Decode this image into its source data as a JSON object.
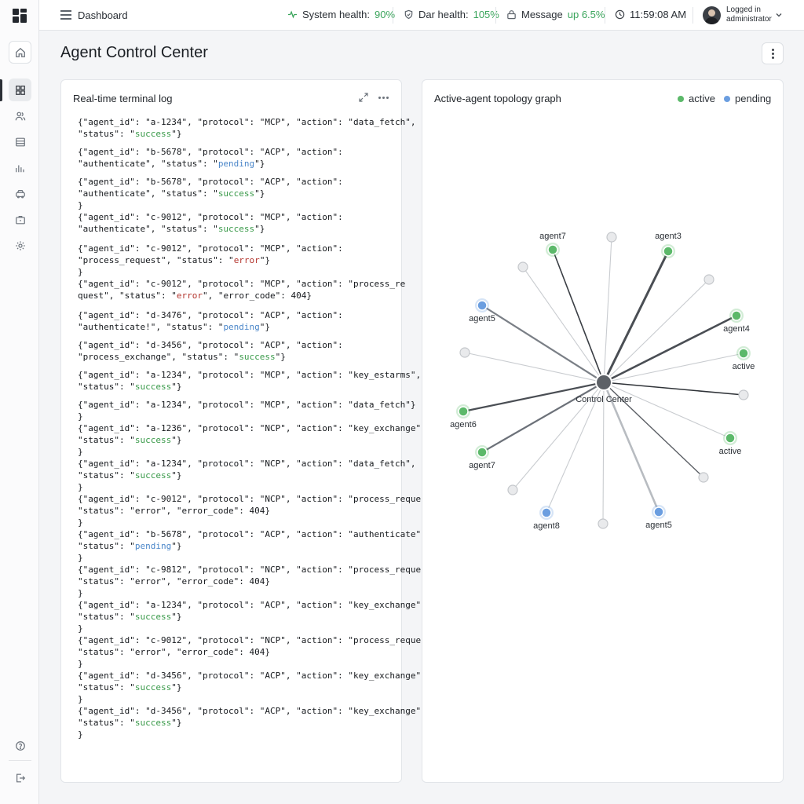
{
  "header": {
    "breadcrumb": "Dashboard",
    "system_health_label": "System health:",
    "system_health_value": "90%",
    "dar_health_label": "Dar health:",
    "dar_health_value": "105%",
    "message_label": "Message",
    "message_value": "up 6.5%",
    "clock": "11:59:08 AM",
    "user_line1": "Logged in",
    "user_line2": "administrator"
  },
  "page": {
    "title": "Agent Control Center"
  },
  "colors": {
    "success": "#3a9a4a",
    "pending": "#4a86c9",
    "error": "#b4362f",
    "active_node": "#5cb96a",
    "pending_node": "#6b9ee0"
  },
  "log_panel": {
    "title": "Real-time terminal log",
    "entries": [
      {
        "line1": "{\"agent_id\": \"a-1234\", \"protocol\": \"MCP\", \"action\": \"data_fetch\",",
        "pre": "\"status\": \"",
        "status": "success",
        "post": "\"}",
        "tail": ""
      },
      {
        "line1": "{\"agent_id\": \"b-5678\", \"protocol\": \"ACP\", \"action\":",
        "pre": "\"authenticate\", \"status\": \"",
        "status": "pending",
        "post": "\"}",
        "tail": ""
      },
      {
        "line1": "{\"agent_id\": \"b-5678\", \"protocol\": \"ACP\", \"action\":",
        "pre": "\"authenticate\", \"status\": \"",
        "status": "success",
        "post": "\"}",
        "tail": "}"
      },
      {
        "line1": "{\"agent_id\": \"c-9012\", \"protocol\": \"MCP\", \"action\":",
        "pre": "\"authenticate\", \"status\": \"",
        "status": "success",
        "post": "\"}",
        "tail": ""
      },
      {
        "line1": "{\"agent_id\": \"c-9012\", \"protocol\": \"MCP\", \"action\":",
        "pre": "\"process_request\", \"status\": \"",
        "status": "error",
        "post": "\"}",
        "tail": "}"
      },
      {
        "line1": "{\"agent_id\": \"c-9012\", \"protocol\": \"MCP\", \"action\": \"process_re",
        "pre": "quest\", \"status\": \"",
        "status": "error",
        "post": "\", \"error_code\": 404}",
        "tail": ""
      },
      {
        "line1": "{\"agent_id\": \"d-3476\", \"protocol\": \"ACP\", \"action\":",
        "pre": "\"authenticate!\", \"status\": \"",
        "status": "pending",
        "post": "\"}",
        "tail": ""
      },
      {
        "line1": "{\"agent_id\": \"d-3456\", \"protocol\": \"ACP\", \"action\":",
        "pre": "\"process_exchange\", \"status\": \"",
        "status": "success",
        "post": "\"}",
        "tail": ""
      },
      {
        "line1": "{\"agent_id\": \"a-1234\", \"protocol\": \"MCP\", \"action\": \"key_estarms\",",
        "pre": "\"status\": \"",
        "status": "success",
        "post": "\"}",
        "tail": ""
      },
      {
        "line1": "{\"agent_id\": \"a-1234\", \"protocol\": \"MCP\", \"action\": \"data_fetch\"}",
        "pre": "}",
        "status": "",
        "post": "",
        "tail": ""
      },
      {
        "line1": "{\"agent_id\": \"a-1236\", \"protocol\": \"NCP\", \"action\": \"key_exchange\",",
        "pre": "\"status\": \"",
        "status": "success",
        "post": "\"}",
        "tail": "}"
      },
      {
        "line1": "{\"agent_id\": \"a-1234\", \"protocol\": \"NCP\", \"action\": \"data_fetch\",",
        "pre": "\"status\": \"",
        "status": "success",
        "post": "\"}",
        "tail": "}"
      },
      {
        "line1": "{\"agent_id\": \"c-9012\", \"protocol\": \"NCP\", \"action\": \"process_request\",",
        "pre": "\"status\": \"error\", \"error_code\": 404}",
        "status": "",
        "post": "",
        "tail": "}"
      },
      {
        "line1": "{\"agent_id\": \"b-5678\", \"protocol\": \"ACP\", \"action\": \"authenticate\",",
        "pre": "\"status\": \"",
        "status": "pending",
        "post": "\"}",
        "tail": "}"
      },
      {
        "line1": "{\"agent_id\": \"c-9812\", \"protocol\": \"NCP\", \"action\": \"process_request\",",
        "pre": "\"status\": \"error\", \"error_code\": 404}",
        "status": "",
        "post": "",
        "tail": "}"
      },
      {
        "line1": "{\"agent_id\": \"a-1234\", \"protocol\": \"ACP\", \"action\": \"key_exchange\",",
        "pre": "\"status\": \"",
        "status": "success",
        "post": "\"}",
        "tail": "}"
      },
      {
        "line1": "{\"agent_id\": \"c-9012\", \"protocol\": \"NCP\", \"action\": \"process_request\",",
        "pre": "\"status\": \"error\", \"error_code\": 404}",
        "status": "",
        "post": "",
        "tail": "}"
      },
      {
        "line1": "{\"agent_id\": \"d-3456\", \"protocol\": \"ACP\", \"action\": \"key_exchange\",",
        "pre": "\"status\": \"",
        "status": "success",
        "post": "\"}",
        "tail": "}"
      },
      {
        "line1": "{\"agent_id\": \"d-3456\", \"protocol\": \"ACP\", \"action\": \"key_exchange\",",
        "pre": "\"status\": \"",
        "status": "success",
        "post": "\"}",
        "tail": "}"
      }
    ]
  },
  "topology": {
    "title": "Active-agent topology graph",
    "legend": [
      {
        "label": "active",
        "color": "#5cb96a"
      },
      {
        "label": "pending",
        "color": "#6b9ee0"
      }
    ],
    "center_label": "Control Center",
    "nodes": [
      {
        "label": "agent7",
        "kind": "active"
      },
      {
        "label": "",
        "kind": "idle"
      },
      {
        "label": "agent3",
        "kind": "active"
      },
      {
        "label": "",
        "kind": "idle"
      },
      {
        "label": "",
        "kind": "idle"
      },
      {
        "label": "agent4",
        "kind": "active"
      },
      {
        "label": "active",
        "kind": "active"
      },
      {
        "label": "agent5",
        "kind": "pending"
      },
      {
        "label": "",
        "kind": "idle"
      },
      {
        "label": "agent6",
        "kind": "active"
      },
      {
        "label": "agent7",
        "kind": "active"
      },
      {
        "label": "",
        "kind": "idle"
      },
      {
        "label": "agent8",
        "kind": "pending"
      },
      {
        "label": "",
        "kind": "idle"
      },
      {
        "label": "",
        "kind": "idle"
      },
      {
        "label": "agent5",
        "kind": "pending"
      },
      {
        "label": "active",
        "kind": "active"
      },
      {
        "label": "",
        "kind": "idle"
      }
    ]
  }
}
